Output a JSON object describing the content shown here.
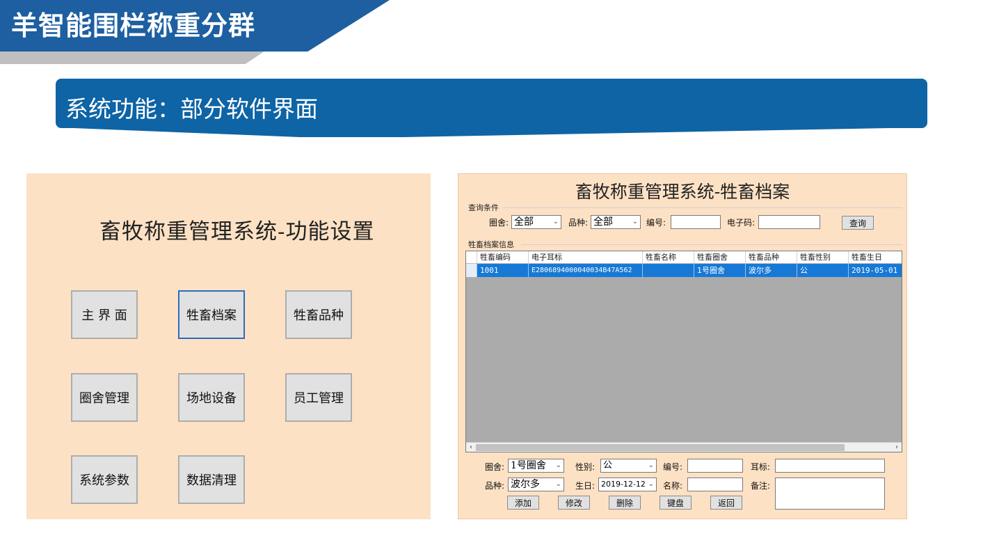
{
  "slide": {
    "title": "羊智能围栏称重分群",
    "subtitle": "系统功能：部分软件界面"
  },
  "left_panel": {
    "title": "畜牧称重管理系统-功能设置",
    "buttons": [
      {
        "label": "主 界 面"
      },
      {
        "label": "牲畜档案"
      },
      {
        "label": "牲畜品种"
      },
      {
        "label": "圈舍管理"
      },
      {
        "label": "场地设备"
      },
      {
        "label": "员工管理"
      },
      {
        "label": "系统参数"
      },
      {
        "label": "数据清理"
      }
    ],
    "active_button": "牲畜档案"
  },
  "right_panel": {
    "title": "畜牧称重管理系统-牲畜档案",
    "query": {
      "group_label": "查询条件",
      "pen_label": "圈舍:",
      "pen_value": "全部",
      "breed_label": "品种:",
      "breed_value": "全部",
      "number_label": "编号:",
      "number_value": "",
      "etag_label": "电子码:",
      "etag_value": "",
      "query_button": "查询"
    },
    "info_group_label": "牲畜档案信息",
    "table": {
      "columns": [
        "牲畜编码",
        "电子耳标",
        "牲畜名称",
        "牲畜圈舍",
        "牲畜品种",
        "牲畜性别",
        "牲畜生日"
      ],
      "rows": [
        [
          "1001",
          "E2806894000040034B47A562",
          "",
          "1号圈舍",
          "波尔多",
          "公",
          "2019-05-01"
        ]
      ]
    },
    "form": {
      "pen_label": "圈舍:",
      "pen_value": "1号圈舍",
      "gender_label": "性别:",
      "gender_value": "公",
      "number_label": "编号:",
      "number_value": "",
      "eartag_label": "耳标:",
      "eartag_value": "",
      "breed_label": "品种:",
      "breed_value": "波尔多",
      "birthday_label": "生日:",
      "birthday_value": "2019-12-12",
      "name_label": "名称:",
      "name_value": "",
      "remark_label": "备注:",
      "remark_value": ""
    },
    "buttons": {
      "add": "添加",
      "modify": "修改",
      "delete": "删除",
      "keyboard": "键盘",
      "back": "返回"
    }
  },
  "colors": {
    "header_blue": "#1d5fa0",
    "subbar_blue": "#0e64a5",
    "panel_bg": "#fde1c4",
    "row_selected": "#1779d6"
  }
}
